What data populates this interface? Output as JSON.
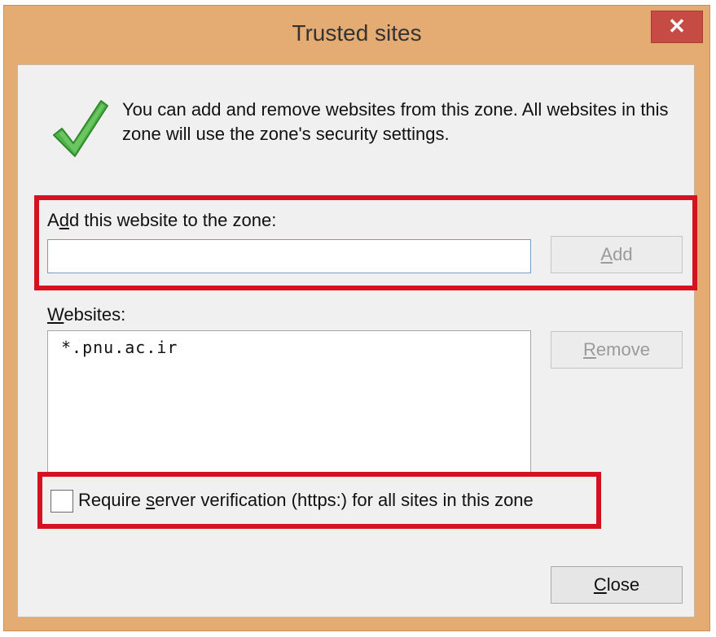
{
  "window": {
    "title": "Trusted sites",
    "close_glyph": "✕"
  },
  "info": {
    "text": "You can add and remove websites from this zone. All websites in this zone will use the zone's security settings.",
    "icon": "check-icon"
  },
  "add_section": {
    "label_pre": "A",
    "label_mnemonic": "d",
    "label_post": "d this website to the zone:",
    "input_value": "",
    "add_button_mnemonic": "A",
    "add_button_rest": "dd"
  },
  "websites_section": {
    "label_mnemonic": "W",
    "label_rest": "ebsites:",
    "items": [
      "*.pnu.ac.ir"
    ],
    "remove_button_mnemonic": "R",
    "remove_button_rest": "emove"
  },
  "verification": {
    "label_pre": "Require ",
    "label_mnemonic": "s",
    "label_post": "erver verification (https:) for all sites in this zone",
    "checked": false
  },
  "footer": {
    "close_mnemonic": "C",
    "close_rest": "lose"
  },
  "colors": {
    "window_frame": "#e4ac72",
    "close_button": "#c64b44",
    "highlight_red": "#d5121f",
    "client_bg": "#f0f0f0"
  }
}
